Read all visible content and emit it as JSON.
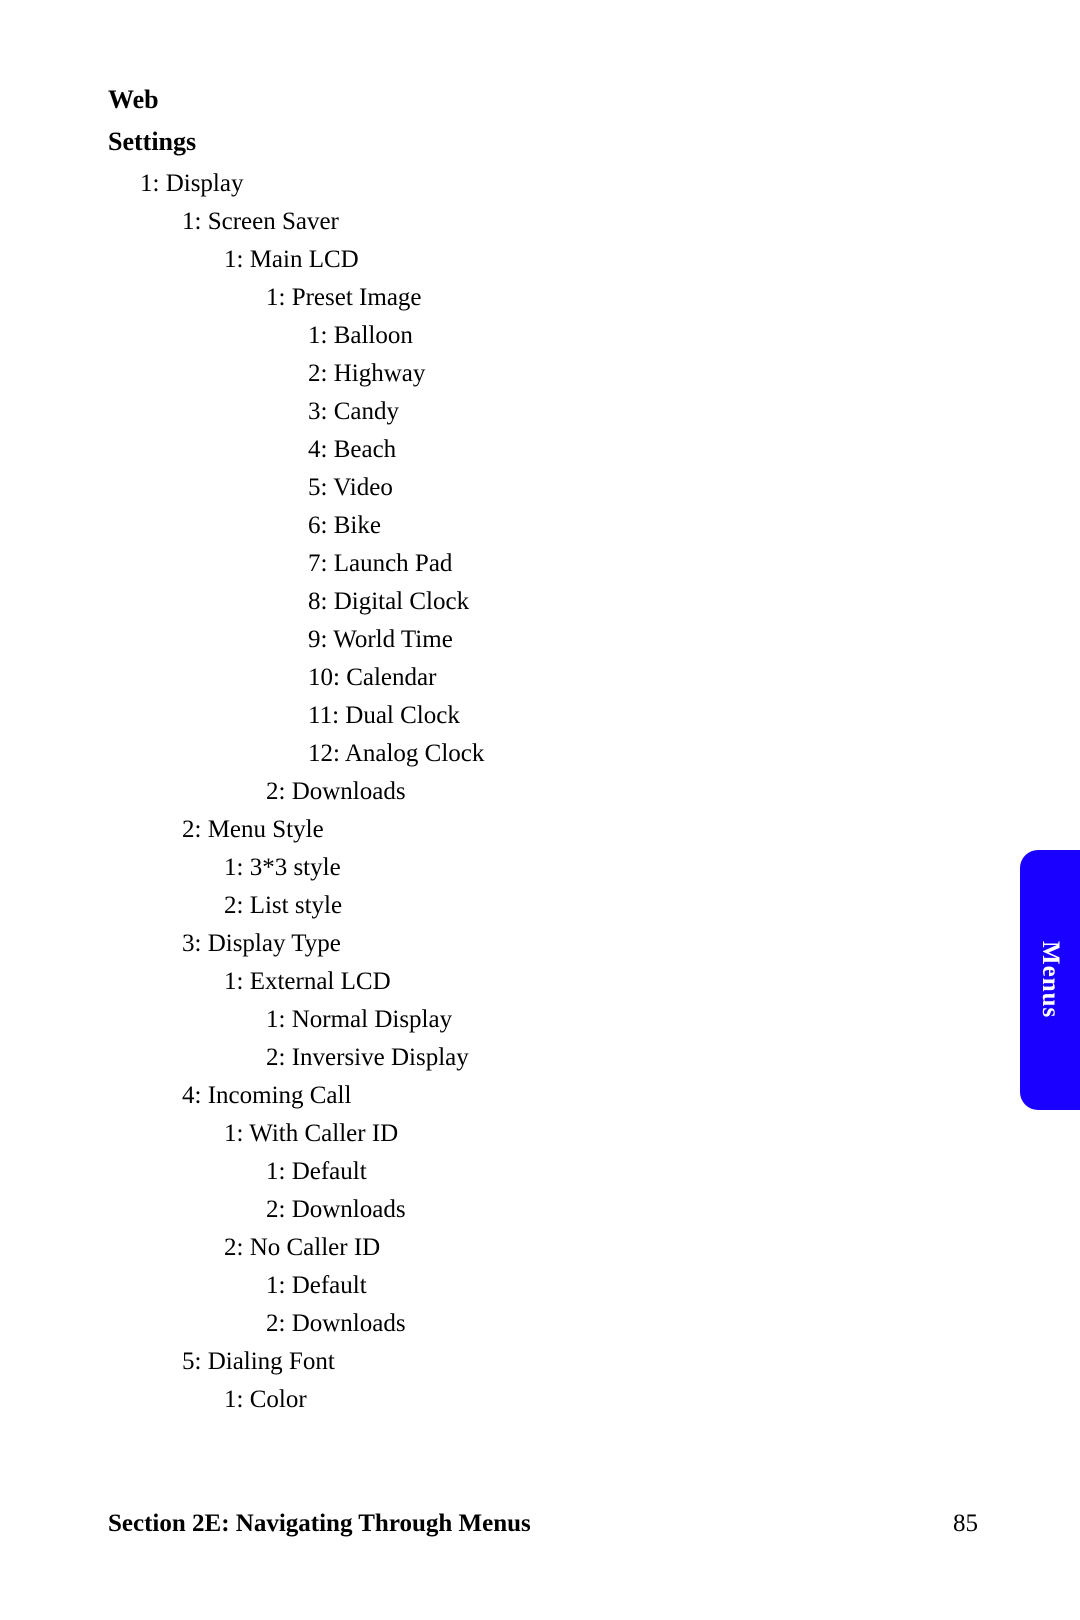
{
  "headings": {
    "web": "Web",
    "settings": "Settings"
  },
  "tree": {
    "display": "1: Display",
    "screenSaver": "1: Screen Saver",
    "mainLCD": "1: Main LCD",
    "presetImage": "1: Preset Image",
    "preset": {
      "balloon": "1: Balloon",
      "highway": "2: Highway",
      "candy": "3: Candy",
      "beach": "4: Beach",
      "video": "5: Video",
      "bike": "6: Bike",
      "launchPad": "7: Launch Pad",
      "digitalClock": "8: Digital Clock",
      "worldTime": "9: World Time",
      "calendar": "10: Calendar",
      "dualClock": "11: Dual Clock",
      "analogClock": "12: Analog Clock"
    },
    "downloads1": "2: Downloads",
    "menuStyle": "2: Menu Style",
    "style3x3": "1: 3*3 style",
    "listStyle": "2: List style",
    "displayType": "3: Display Type",
    "externalLCD": "1: External LCD",
    "normalDisplay": "1: Normal Display",
    "inversiveDisplay": "2: Inversive Display",
    "incomingCall": "4: Incoming Call",
    "withCallerID": "1: With Caller ID",
    "wcid_default": "1: Default",
    "wcid_downloads": "2: Downloads",
    "noCallerID": "2: No Caller ID",
    "ncid_default": "1: Default",
    "ncid_downloads": "2: Downloads",
    "dialingFont": "5: Dialing Font",
    "color": "1: Color"
  },
  "footer": {
    "section": "Section 2E: Navigating Through Menus",
    "page": "85"
  },
  "tab": {
    "label": "Menus"
  }
}
